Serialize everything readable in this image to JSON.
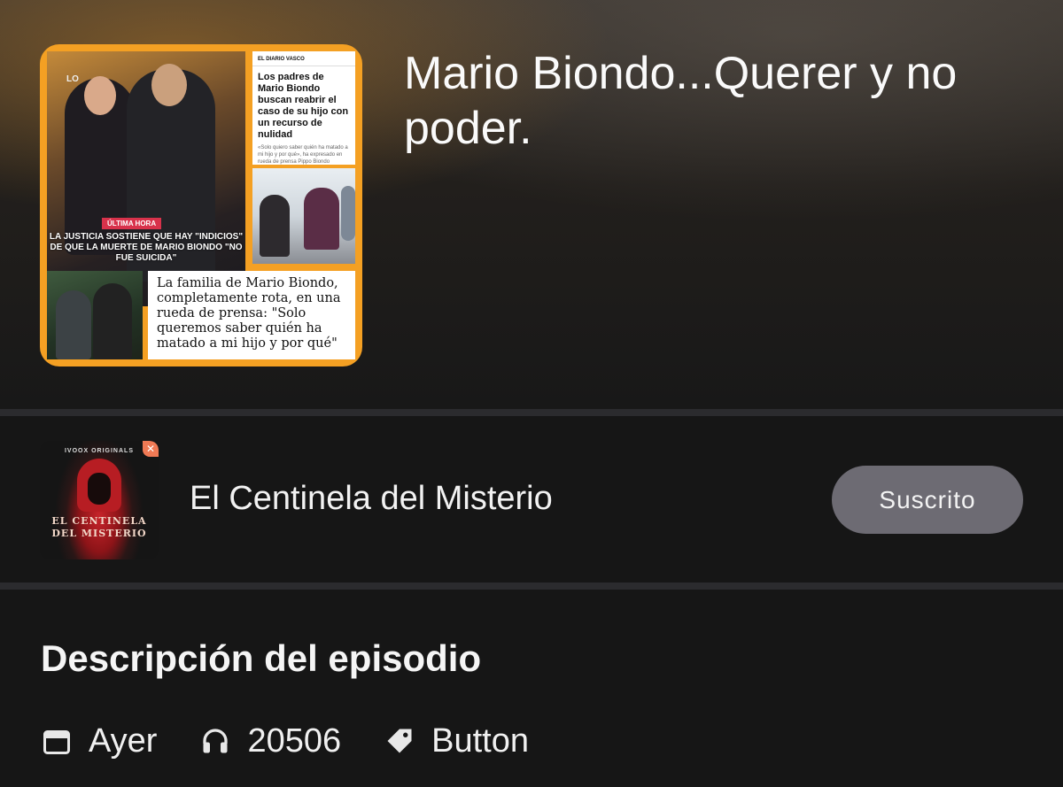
{
  "episode": {
    "title": "Mario Biondo...Querer y no poder.",
    "cover": {
      "photo_caption_tag": "ÚLTIMA HORA",
      "photo_caption": "LA JUSTICIA SOSTIENE QUE HAY \"INDICIOS\" DE QUE LA MUERTE DE MARIO BIONDO \"NO FUE SUICIDA\"",
      "photo_logo": "LO",
      "news_paper": "EL DIARIO VASCO",
      "news_headline": "Los padres de Mario Biondo buscan reabrir el caso de su hijo con un recurso de nulidad",
      "news_sub": "«Solo quiero saber quién ha matado a mi hijo y por qué», ha expresado en rueda de prensa Pippo Biondo",
      "news2_headline": "La familia de Mario Biondo, completamente rota, en una rueda de prensa: \"Solo queremos saber quién ha matado a mi hijo y por qué\""
    }
  },
  "podcast": {
    "name": "El Centinela del Misterio",
    "thumb_brand": "IVOOX ORIGINALS",
    "thumb_title_line1": "EL CENTINELA",
    "thumb_title_line2": "DEL MISTERIO",
    "thumb_badge": "✕",
    "subscribe_label": "Suscrito"
  },
  "description": {
    "heading": "Descripción del episodio",
    "meta": {
      "date": "Ayer",
      "plays": "20506",
      "tag": "Button"
    }
  },
  "icons": {
    "date": "calendar-icon",
    "plays": "headphones-icon",
    "tag": "tag-icon"
  },
  "colors": {
    "background": "#161616",
    "subscribe_button": "#6d6b73",
    "cover_border": "#f4a023",
    "accent_badge": "#f07a55"
  }
}
